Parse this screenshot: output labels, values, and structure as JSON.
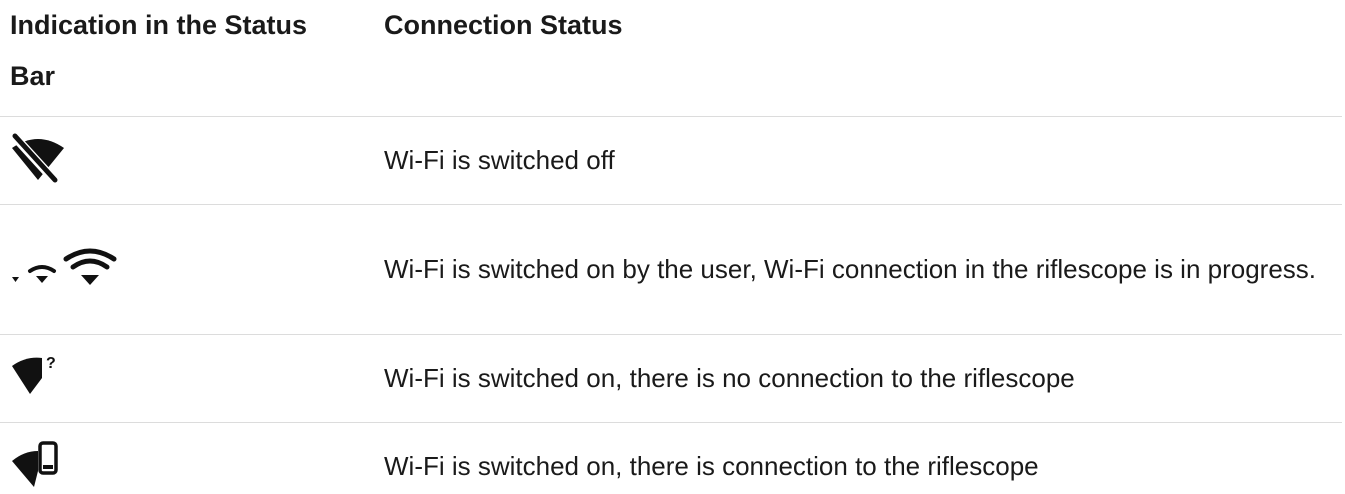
{
  "table": {
    "headers": {
      "indication": "Indication in the Status Bar",
      "status": "Connection Status"
    },
    "rows": [
      {
        "icon": "wifi-off-icon",
        "status": "Wi-Fi is switched off"
      },
      {
        "icon": "wifi-connecting-icon",
        "status": "Wi-Fi is switched on by the user, Wi-Fi connection in the riflescope is in progress."
      },
      {
        "icon": "wifi-no-connection-icon",
        "status": "Wi-Fi is switched on, there is no connection to the riflescope"
      },
      {
        "icon": "wifi-connected-device-icon",
        "status": "Wi-Fi is switched on, there is connection to the riflescope"
      }
    ]
  }
}
